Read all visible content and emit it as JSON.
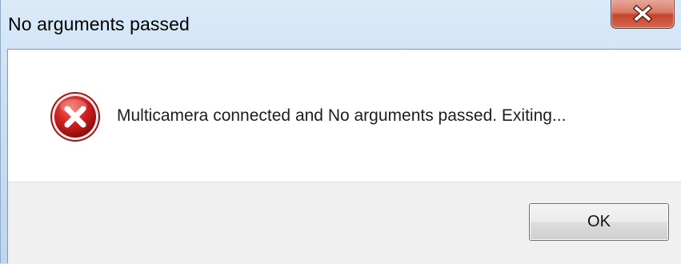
{
  "window": {
    "title": "No arguments passed"
  },
  "dialog": {
    "icon": "error-icon",
    "message": "Multicamera connected and No arguments passed. Exiting...",
    "ok_label": "OK"
  },
  "colors": {
    "titlebar": "#c9dff5",
    "close_button": "#c4452d",
    "error_icon": "#d11f1f",
    "content_background": "#ffffff",
    "button_area_background": "#f0f0f0"
  }
}
